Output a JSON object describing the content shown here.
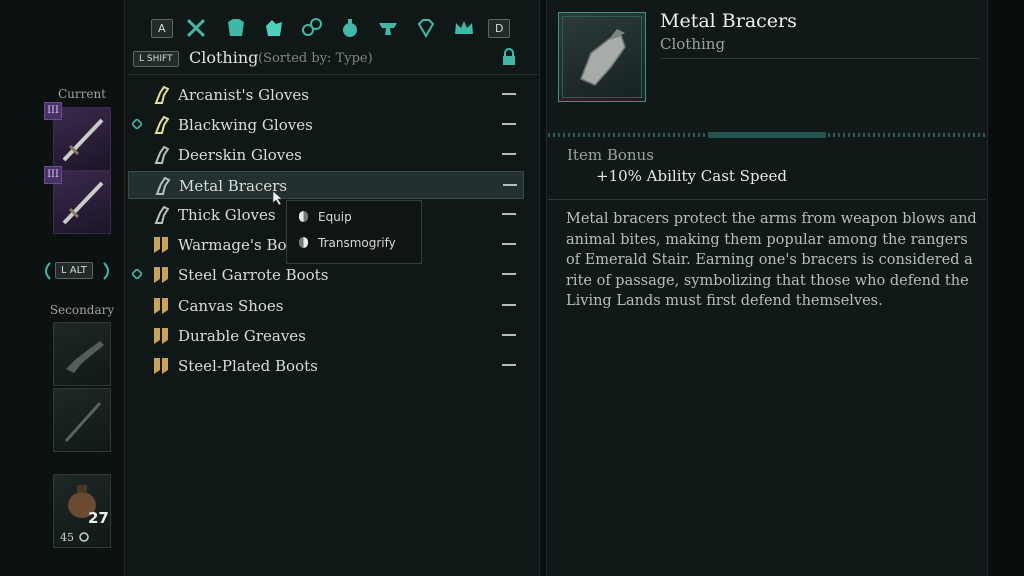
{
  "left": {
    "current_label": "Current",
    "secondary_label": "Secondary",
    "tier_1": "III",
    "tier_2": "III",
    "swap_key": "L ALT",
    "potion_count": "27",
    "currency": "45"
  },
  "inventory": {
    "key_prev": "A",
    "key_next": "D",
    "category_tabs": [
      "crossed-weapons-icon",
      "armor-icon",
      "clothing-icon",
      "rings-icon",
      "potion-icon",
      "anvil-icon",
      "gem-icon",
      "crown-icon"
    ],
    "sort_key": "L SHIFT",
    "category": "Clothing",
    "sort_text": "(Sorted by: Type)",
    "items": [
      {
        "name": "Arcanist's Gloves",
        "icon": "gloves-icon",
        "marked": false
      },
      {
        "name": "Blackwing Gloves",
        "icon": "gloves-icon",
        "marked": true
      },
      {
        "name": "Deerskin Gloves",
        "icon": "gloves-icon",
        "marked": false
      },
      {
        "name": "Metal Bracers",
        "icon": "gloves-icon",
        "marked": false,
        "selected": true
      },
      {
        "name": "Thick Gloves",
        "icon": "gloves-icon",
        "marked": false
      },
      {
        "name": "Warmage's Boo",
        "icon": "boots-icon",
        "marked": false
      },
      {
        "name": "Steel Garrote Boots",
        "icon": "boots-icon",
        "marked": true
      },
      {
        "name": "Canvas Shoes",
        "icon": "boots-icon",
        "marked": false
      },
      {
        "name": "Durable Greaves",
        "icon": "boots-icon",
        "marked": false
      },
      {
        "name": "Steel-Plated Boots",
        "icon": "boots-icon",
        "marked": false
      }
    ],
    "item_value": "—"
  },
  "context_menu": {
    "equip": "Equip",
    "transmogrify": "Transmogrify"
  },
  "detail": {
    "name": "Metal Bracers",
    "type": "Clothing",
    "bonus_heading": "Item Bonus",
    "bonus": "+10% Ability Cast Speed",
    "description": "Metal bracers protect the arms from weapon blows and animal bites, making them popular among the rangers of Emerald Stair. Earning one's bracers is considered a rite of passage, symbolizing that those who defend the Living Lands must first defend themselves."
  },
  "colors": {
    "accent_teal": "#3fb8a8",
    "boots_gold": "#c9a35a",
    "background": "#101717"
  }
}
